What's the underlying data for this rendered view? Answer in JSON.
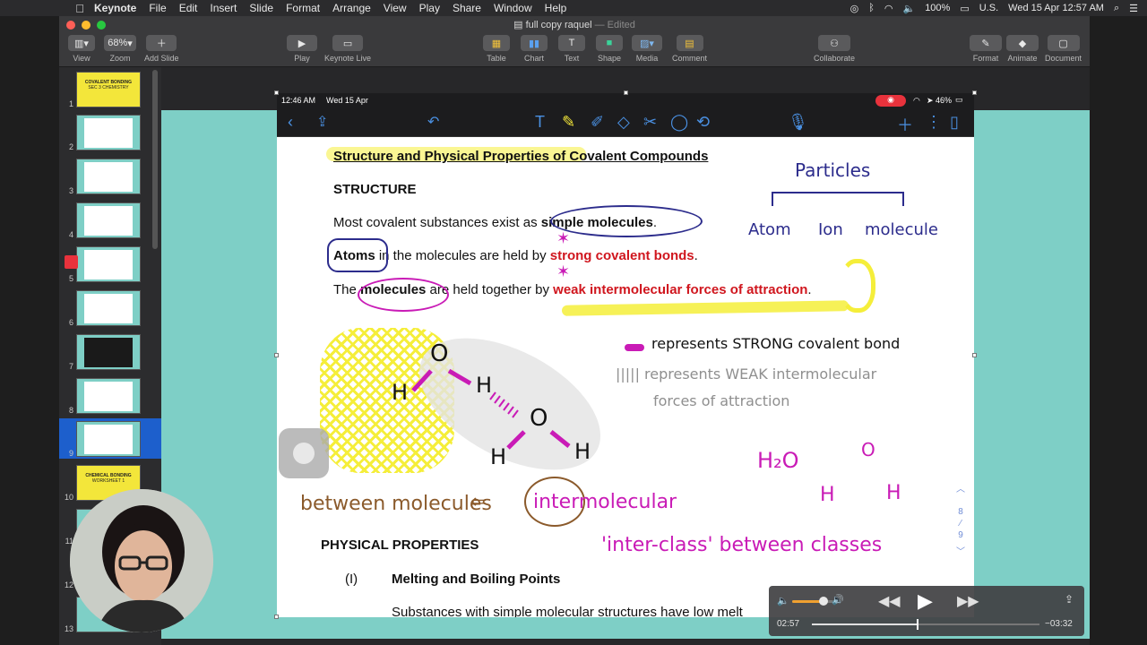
{
  "menubar": {
    "app": "Keynote",
    "items": [
      "File",
      "Edit",
      "Insert",
      "Slide",
      "Format",
      "Arrange",
      "View",
      "Play",
      "Share",
      "Window",
      "Help"
    ],
    "battery": "100%",
    "locale": "U.S.",
    "clock": "Wed 15 Apr  12:57 AM"
  },
  "window": {
    "doc_title": "full copy raquel",
    "edited": "— Edited",
    "zoom": "68%",
    "toolbar": {
      "view": "View",
      "zoom": "Zoom",
      "add_slide": "Add Slide",
      "play": "Play",
      "keynote_live": "Keynote Live",
      "table": "Table",
      "chart": "Chart",
      "text": "Text",
      "shape": "Shape",
      "media": "Media",
      "comment": "Comment",
      "collaborate": "Collaborate",
      "format": "Format",
      "animate": "Animate",
      "document": "Document"
    }
  },
  "navigator": {
    "slides": [
      {
        "num": "1",
        "title": "COVALENT BONDING",
        "subtitle": "SEC 3 CHEMISTRY",
        "bg": "#f3e63a"
      },
      {
        "num": "2",
        "bg": "#7ecfc6"
      },
      {
        "num": "3",
        "bg": "#7ecfc6"
      },
      {
        "num": "4",
        "bg": "#7ecfc6"
      },
      {
        "num": "5",
        "bg": "#7ecfc6"
      },
      {
        "num": "6",
        "bg": "#7ecfc6"
      },
      {
        "num": "7",
        "bg": "#7ecfc6"
      },
      {
        "num": "8",
        "bg": "#7ecfc6"
      },
      {
        "num": "9",
        "bg": "#7ecfc6"
      },
      {
        "num": "10",
        "title": "CHEMICAL BONDING",
        "subtitle": "WORKSHEET 1",
        "bg": "#f3e63a"
      },
      {
        "num": "11",
        "bg": "#7ecfc6"
      },
      {
        "num": "12",
        "bg": "#7ecfc6"
      },
      {
        "num": "13",
        "bg": "#7ecfc6"
      }
    ]
  },
  "ipad": {
    "time": "12:46 AM",
    "date": "Wed 15 Apr",
    "battery": "46%"
  },
  "sheet": {
    "heading": "Structure and Physical Properties of Covalent Compounds",
    "structure": "STRUCTURE",
    "line1_pre": "Most covalent substances exist as ",
    "line1_bold": "simple molecules",
    "line1_post": ".",
    "line2_bold": "Atoms",
    "line2_mid": " in the molecules are held by ",
    "line2_red": "strong covalent bonds",
    "line2_post": ".",
    "line3_pre": "The ",
    "line3_bold": "molecules",
    "line3_mid": " are held together by ",
    "line3_red": "weak intermolecular forces of attraction",
    "line3_post": ".",
    "physical": "PHYSICAL PROPERTIES",
    "item_num": "(I)",
    "item_title": "Melting and Boiling Points",
    "item_body": "Substances with simple molecular structures have low melt"
  },
  "annotations": {
    "particles": "Particles",
    "branch1": "Atom",
    "branch2": "Ion",
    "branch3": "molecule",
    "strong_legend": "represents STRONG covalent bond",
    "weak_legend_1": "||||| represents WEAK intermolecular",
    "weak_legend_2": "forces of attraction",
    "h2o": "H₂O",
    "between": "between molecules",
    "intermolecular": "intermolecular",
    "interclass": "'inter-class' between classes",
    "mol_O1": "O",
    "mol_H1": "H",
    "mol_H2": "H",
    "mol_O2": "O",
    "mol_H3": "H",
    "mol_H4": "H",
    "mini_O": "O",
    "mini_H1": "H",
    "mini_H2": "H"
  },
  "page_indicator": {
    "current": "8",
    "total": "9"
  },
  "video": {
    "elapsed": "02:57",
    "remaining": "−03:32",
    "volume": 0.75,
    "progress": 0.46
  },
  "colors": {
    "highlight": "#f5ee3a",
    "pen_blue": "#2c2c8c",
    "pen_magenta": "#c91bb6",
    "pen_brown": "#8b5a2b",
    "accent": "#1d5fcc"
  }
}
